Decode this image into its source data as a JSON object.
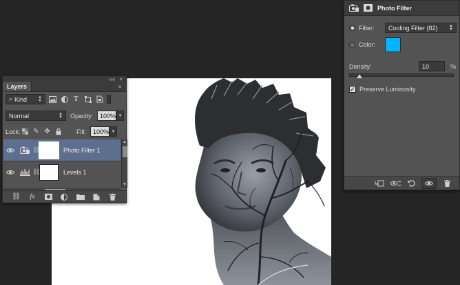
{
  "layers_panel": {
    "collapse_glyph": "««",
    "close_glyph": "×",
    "tab_label": "Layers",
    "menu_glyph": "≡",
    "kind_filter": "Kind",
    "blend_mode": "Normal",
    "opacity_label": "Opacity:",
    "opacity_value": "100%",
    "lock_label": "Lock:",
    "fill_label": "Fill:",
    "fill_value": "100%",
    "filter_icons": [
      "image-filter-icon",
      "adjustment-filter-icon",
      "type-filter-icon",
      "shape-filter-icon",
      "smart-object-filter-icon"
    ],
    "lock_icons": [
      "lock-transparent-icon",
      "lock-image-icon",
      "lock-position-icon",
      "lock-all-icon"
    ],
    "layers": [
      {
        "name": "Photo Filter 1",
        "selected": true,
        "visible": true,
        "adjustment_icon": "photo-filter-adjustment-icon"
      },
      {
        "name": "Levels 1",
        "selected": false,
        "visible": true,
        "adjustment_icon": "levels-adjustment-icon"
      }
    ],
    "footer_icons": [
      "link-layers-icon",
      "fx-icon",
      "add-mask-icon",
      "new-adjustment-icon",
      "new-group-icon",
      "new-layer-icon",
      "delete-layer-icon"
    ]
  },
  "properties_panel": {
    "title": "Photo Filter",
    "header_icons": [
      "photo-filter-adjustment-icon",
      "mask-icon"
    ],
    "filter_label": "Filter:",
    "filter_value": "Cooling Filter (82)",
    "filter_selected": true,
    "color_label": "Color:",
    "color_selected": false,
    "color_swatch": "#00b4ff",
    "density_label": "Density:",
    "density_value": "10",
    "density_unit": "%",
    "density_fraction": 0.1,
    "preserve_luminosity_label": "Preserve Luminosity",
    "preserve_luminosity_checked": true,
    "footer_icons": [
      "clip-to-layer-icon",
      "view-previous-state-icon",
      "reset-icon",
      "toggle-visibility-icon",
      "delete-adjustment-icon"
    ]
  },
  "canvas": {
    "image": "double-exposure-portrait"
  },
  "colors": {
    "panel_bg": "#535353",
    "selected_layer": "#5d6f8f",
    "workspace": "#252525"
  }
}
